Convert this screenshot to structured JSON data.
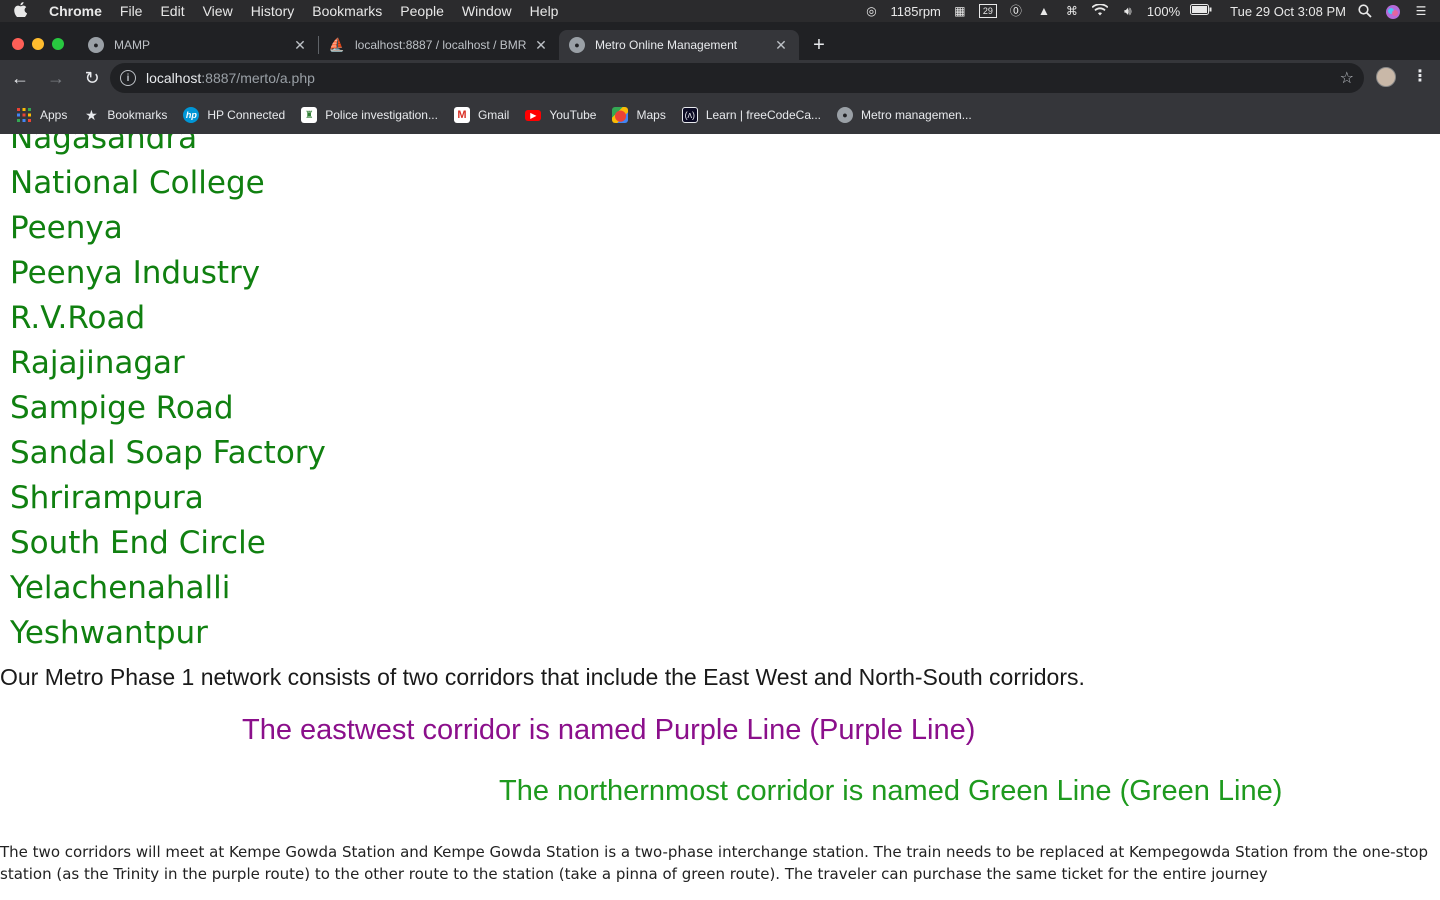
{
  "menubar": {
    "apple": "",
    "items": [
      "Chrome",
      "File",
      "Edit",
      "View",
      "History",
      "Bookmarks",
      "People",
      "Window",
      "Help"
    ],
    "status": {
      "fan": "1185rpm",
      "calendar_day": "29",
      "battery": "100%",
      "datetime": "Tue 29 Oct  3:08 PM"
    }
  },
  "tabs": [
    {
      "title": "MAMP",
      "close": "✕"
    },
    {
      "title": "localhost:8887 / localhost / BMR",
      "close": "✕"
    },
    {
      "title": "Metro Online Management",
      "close": "✕"
    }
  ],
  "newtab": "+",
  "toolbar": {
    "back": "←",
    "forward": "→",
    "reload": "↻",
    "info": "i",
    "url_host": "localhost",
    "url_path": ":8887/merto/a.php",
    "star": "☆",
    "menu": "⋮"
  },
  "bookmarks": [
    {
      "label": "Apps",
      "icon": "apps-grid-icon"
    },
    {
      "label": "Bookmarks",
      "icon": "star-icon"
    },
    {
      "label": "HP Connected",
      "icon": "hp-icon"
    },
    {
      "label": "Police investigation...",
      "icon": "police-icon"
    },
    {
      "label": "Gmail",
      "icon": "gmail-icon"
    },
    {
      "label": "YouTube",
      "icon": "youtube-icon"
    },
    {
      "label": "Maps",
      "icon": "maps-icon"
    },
    {
      "label": "Learn | freeCodeCa...",
      "icon": "freecodecamp-icon"
    },
    {
      "label": "Metro managemen...",
      "icon": "elephant-icon"
    }
  ],
  "content": {
    "stations": [
      "Nagasandra",
      "National College",
      "Peenya",
      "Peenya Industry",
      "R.V.Road",
      "Rajajinagar",
      "Sampige Road",
      "Sandal Soap Factory",
      "Shrirampura",
      "South End Circle",
      "Yelachenahalli",
      "Yeshwantpur"
    ],
    "intro": "Our Metro Phase 1 network consists of two corridors that include the East West and North-South corridors.",
    "purple_line": "The eastwest corridor is named Purple Line (Purple Line)",
    "green_line": "The northernmost corridor is named Green Line (Green Line)",
    "description": "The two corridors will meet at Kempe Gowda Station and Kempe Gowda Station is a two-phase interchange station. The train needs to be replaced at Kempegowda Station from the one-stop station (as the Trinity in the purple route) to the other route to the station (take a pinna of green route). The traveler can purchase the same ticket for the entire journey"
  },
  "colors": {
    "station_green": "#108010",
    "purple": "#8b0f8b",
    "green": "#1e9a1e"
  }
}
